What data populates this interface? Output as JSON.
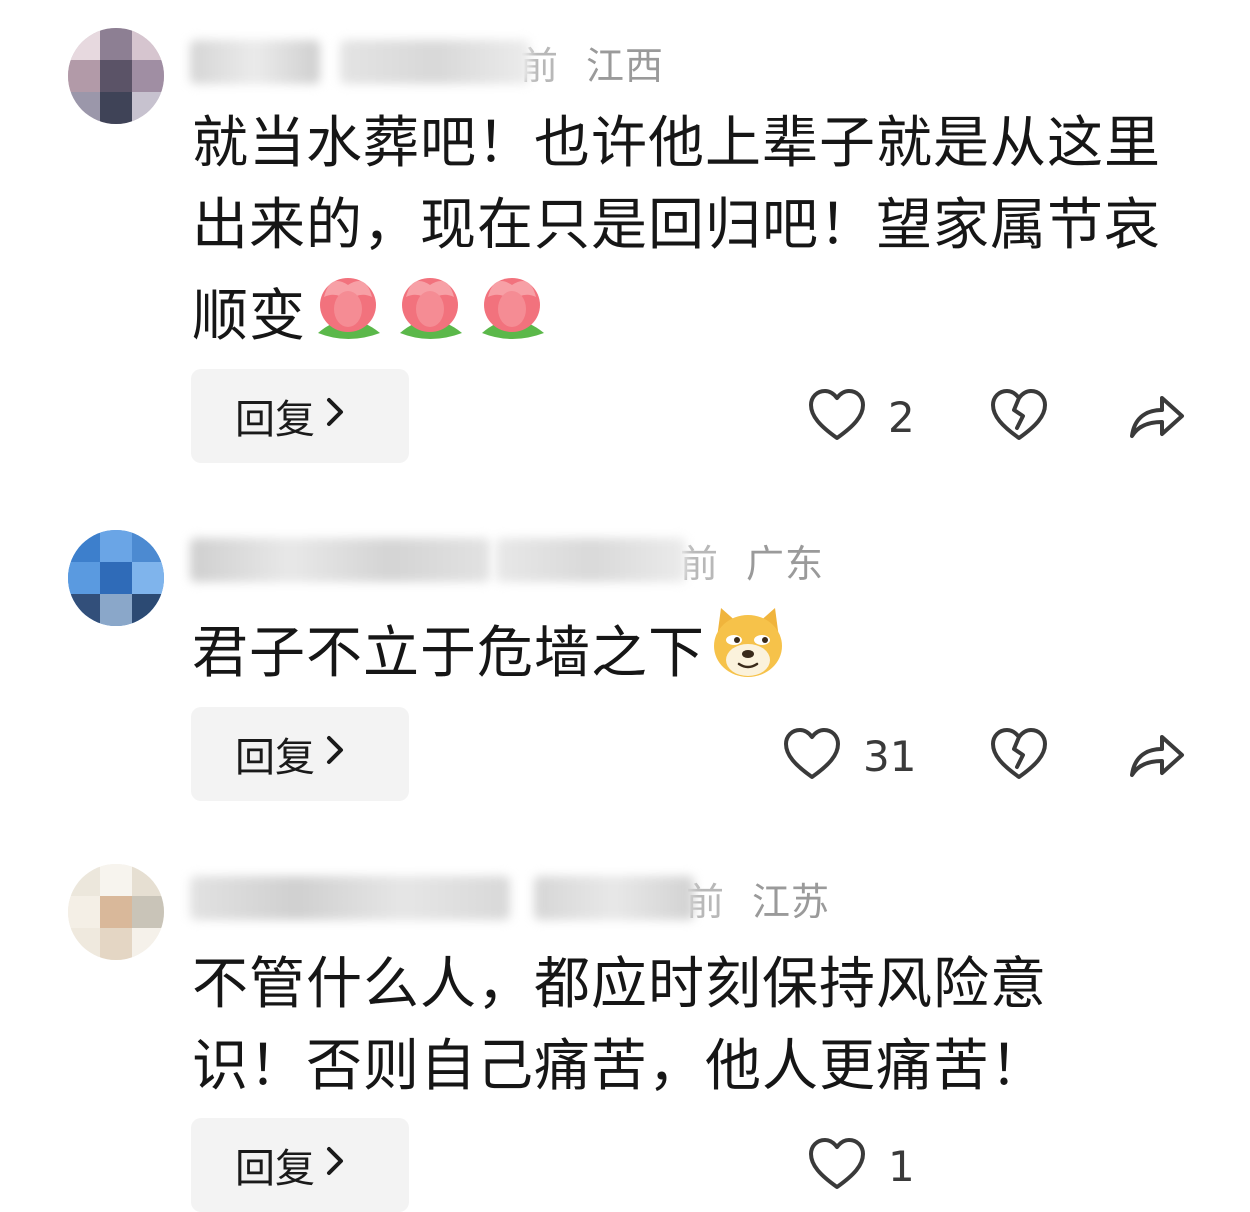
{
  "comments": [
    {
      "time_suffix": "前",
      "location": "江西",
      "text": "就当水葬吧！也许他上辈子就是从这里出来的，现在只是回归吧！望家属节哀顺变",
      "emoji": [
        "tulip-emoji",
        "tulip-emoji",
        "tulip-emoji"
      ],
      "reply_label": "回复",
      "like_count": "2"
    },
    {
      "time_suffix": "前",
      "location": "广东",
      "text": "君子不立于危墙之下",
      "emoji": [
        "doge-emoji"
      ],
      "reply_label": "回复",
      "like_count": "31"
    },
    {
      "time_suffix": "前",
      "location": "江苏",
      "text": "不管什么人，都应时刻保持风险意识！否则自己痛苦，他人更痛苦！",
      "emoji": [],
      "reply_label": "回复",
      "like_count": "1"
    }
  ],
  "icons": {
    "like": "heart-outline-icon",
    "dislike": "broken-heart-icon",
    "share": "share-arrow-icon",
    "reply_chevron": "chevron-right-icon"
  },
  "colors": {
    "meta_text": "#9a9a9a",
    "body_text": "#161616",
    "reply_bg": "#f3f3f3",
    "icon_stroke": "#3a3a3a"
  }
}
